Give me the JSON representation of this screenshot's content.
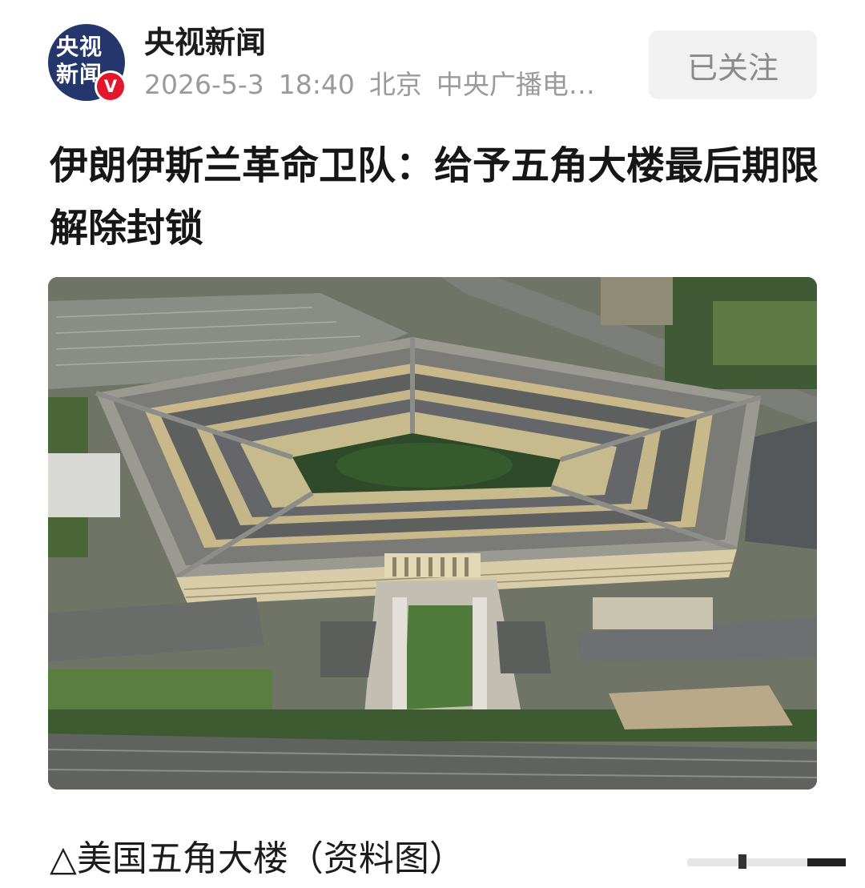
{
  "account": {
    "avatar_line1": "央视",
    "avatar_line2": "新闻",
    "verified_mark": "V",
    "name": "央视新闻",
    "date": "2026-5-3",
    "time": "18:40",
    "location": "北京",
    "source": "中央广播电…",
    "follow_label": "已关注"
  },
  "article": {
    "title": "伊朗伊斯兰革命卫队：给予五角大楼最后期限解除封锁",
    "caption": "△美国五角大楼（资料图）"
  },
  "colors": {
    "avatar_bg": "#24366b",
    "verified_badge": "#e4162b",
    "follow_button_bg": "#f1f1f1"
  },
  "icons": {
    "verified": "verified-badge-icon",
    "scroll": "scroll-indicator"
  }
}
